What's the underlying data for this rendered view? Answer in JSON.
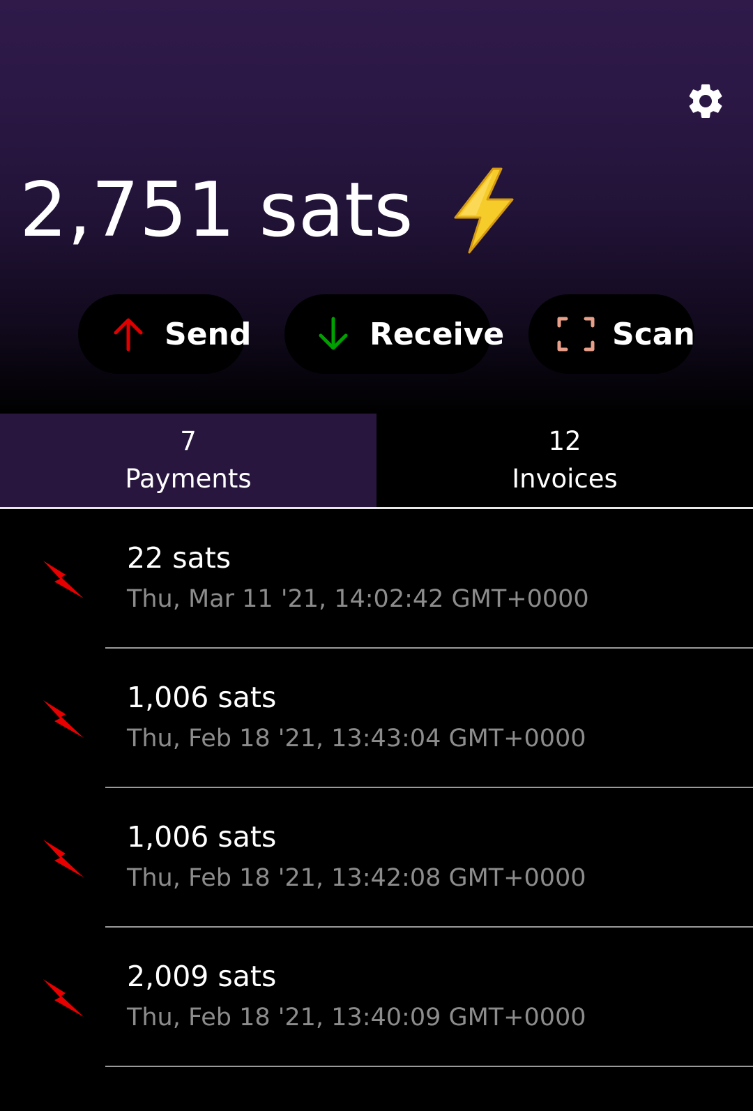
{
  "header": {
    "balance": "2,751 sats",
    "balance_icon": "high-voltage-emoji",
    "settings_icon": "gear-icon"
  },
  "actions": [
    {
      "label": "Send",
      "icon": "arrow-up-icon",
      "color": "#e00000"
    },
    {
      "label": "Receive",
      "icon": "arrow-down-icon",
      "color": "#00a000"
    },
    {
      "label": "Scan",
      "icon": "scan-frame-icon",
      "color": "#e8a08a"
    }
  ],
  "tabs": [
    {
      "count": "7",
      "label": "Payments",
      "active": true
    },
    {
      "count": "12",
      "label": "Invoices",
      "active": false
    }
  ],
  "payments": [
    {
      "amount": "22 sats",
      "date": "Thu, Mar 11 '21, 14:02:42 GMT+0000"
    },
    {
      "amount": "1,006 sats",
      "date": "Thu, Feb 18 '21, 13:43:04 GMT+0000"
    },
    {
      "amount": "1,006 sats",
      "date": "Thu, Feb 18 '21, 13:42:08 GMT+0000"
    },
    {
      "amount": "2,009 sats",
      "date": "Thu, Feb 18 '21, 13:40:09 GMT+0000"
    }
  ],
  "colors": {
    "header_top": "#2f1a4a",
    "active_tab": "#28163e",
    "payment_icon": "#e00000",
    "secondary_text": "#8c8c8c"
  }
}
